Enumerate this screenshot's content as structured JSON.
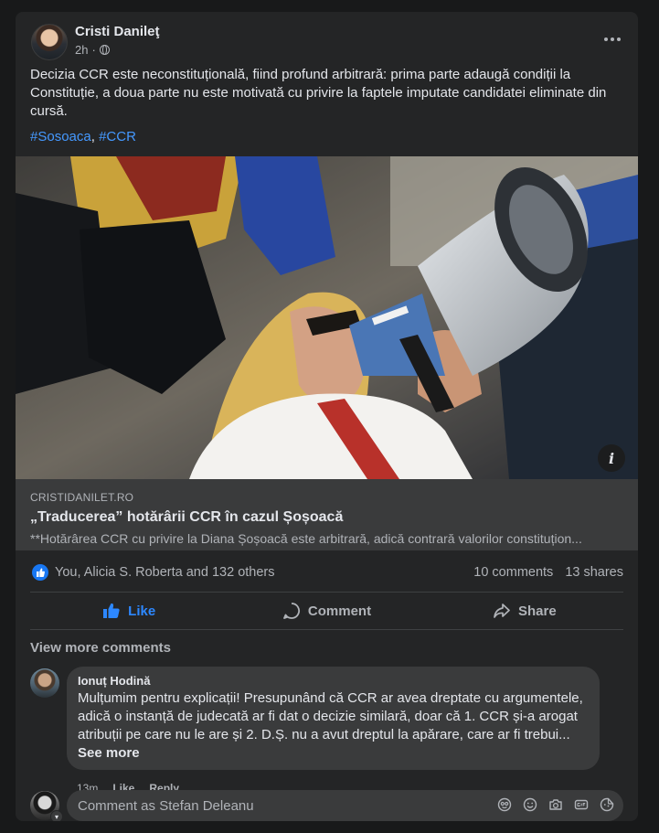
{
  "post": {
    "author": "Cristi Danileţ",
    "time": "2h",
    "separator": "·",
    "text": "Decizia CCR este neconstituțională, fiind profund arbitrară: prima parte adaugă condiții la Constituție, a doua parte nu este motivată cu privire la faptele imputate candidatei eliminate din cursă.",
    "hashtags": [
      "#Sosoaca",
      "#CCR"
    ],
    "hashtag_separator": ", "
  },
  "link": {
    "domain": "CRISTIDANILET.RO",
    "title": "„Traducerea” hotărârii CCR în cazul Șoșoacă",
    "description": "**Hotărârea CCR cu privire la Diana Șoșoacă este arbitrară, adică contrară valorilor constituțion...",
    "info_icon_label": "i"
  },
  "reactions": {
    "summary": "You, Alicia S. Roberta and 132 others",
    "comments": "10 comments",
    "shares": "13 shares"
  },
  "actions": {
    "like": "Like",
    "comment": "Comment",
    "share": "Share"
  },
  "comments": {
    "view_more": "View more comments",
    "items": [
      {
        "author": "Ionuț Hodină",
        "text": "Mulțumim pentru explicații! Presupunând că CCR ar avea dreptate cu argumentele, adică o instanță de judecată ar fi dat o decizie similară, doar că 1. CCR și-a arogat atribuții pe care nu le are și 2. D.Ș. nu a avut dreptul la apărare, care ar fi trebui...",
        "see_more": "See more",
        "time": "13m",
        "like": "Like",
        "reply": "Reply"
      }
    ]
  },
  "composer": {
    "placeholder": "Comment as Stefan Deleanu"
  },
  "colors": {
    "card": "#242526",
    "background": "#18191a",
    "accent": "#2d88ff",
    "hashtag": "#4599ff"
  },
  "icons": [
    "globe-icon",
    "more-icon",
    "info-icon",
    "like-reaction-icon",
    "like-icon",
    "comment-icon",
    "share-icon",
    "avatar-sticker-icon",
    "emoji-icon",
    "camera-icon",
    "gif-icon",
    "sticker-icon",
    "chevron-down-icon"
  ]
}
